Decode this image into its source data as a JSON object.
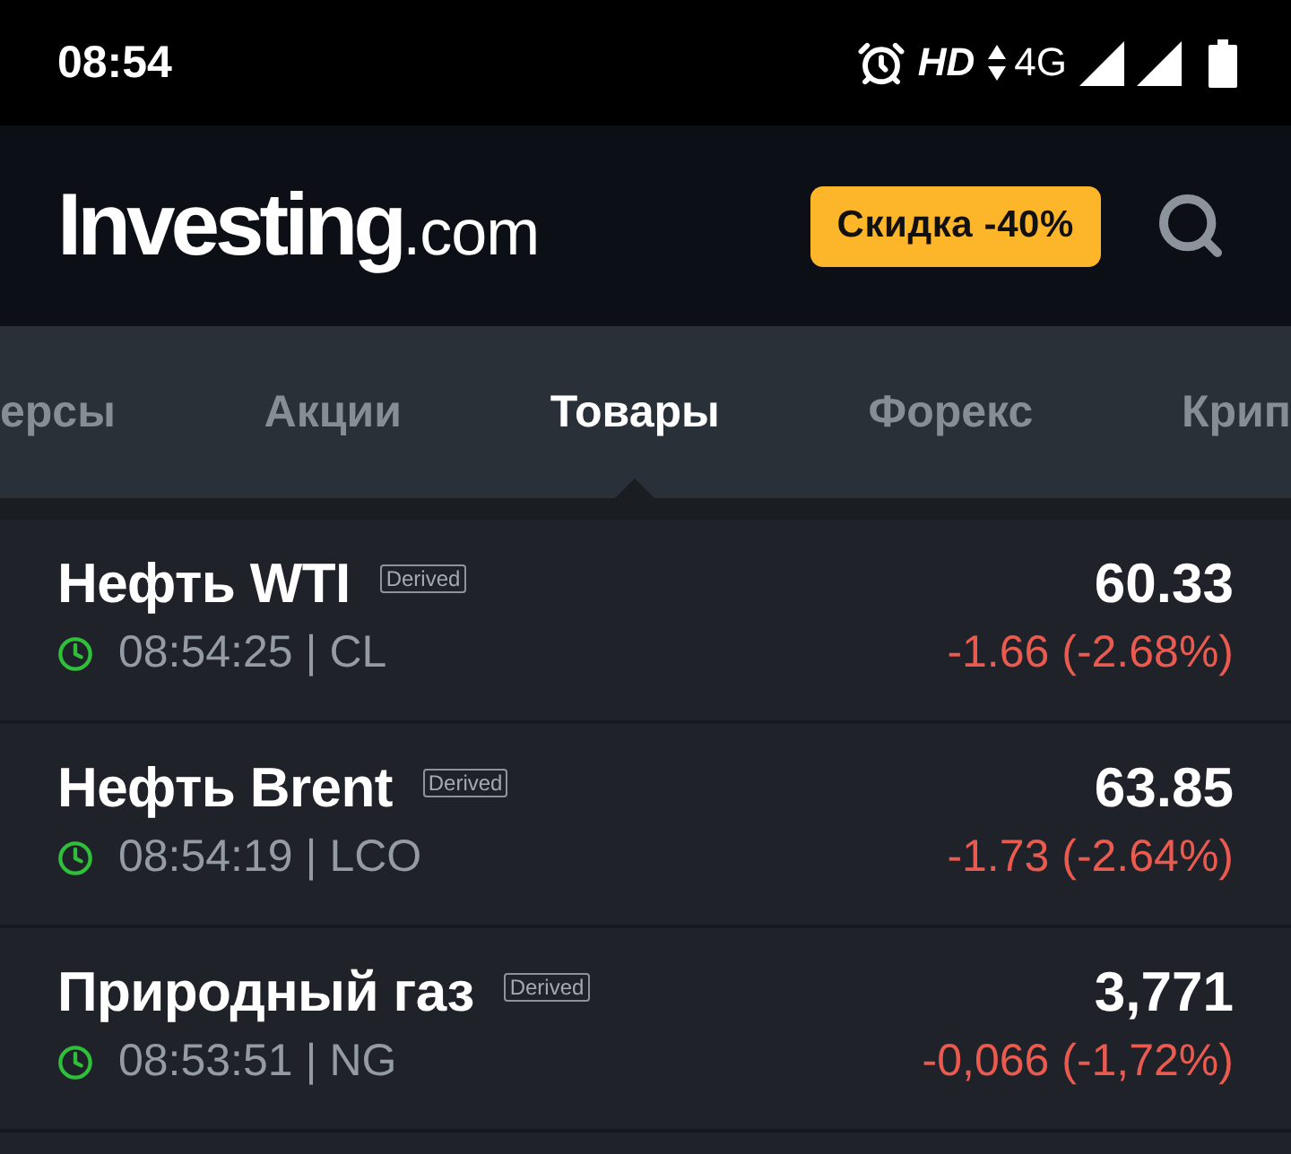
{
  "status_bar": {
    "time": "08:54",
    "hd": "HD",
    "network": "4G"
  },
  "header": {
    "logo": "**Investing**.com",
    "promo": "Скидка -40%"
  },
  "tabs": [
    {
      "label": "ерсы",
      "selected": false
    },
    {
      "label": "Акции",
      "selected": false
    },
    {
      "label": "Товары",
      "selected": true
    },
    {
      "label": "Форекс",
      "selected": false
    },
    {
      "label": "Крип",
      "selected": false
    }
  ],
  "quotes": [
    {
      "name": "Нефть WTI",
      "badge": "Derived",
      "time": "08:54:25 | CL",
      "price": "60.33",
      "change": "-1.66 (-2.68%)",
      "negative": true
    },
    {
      "name": "Нефть Brent",
      "badge": "Derived",
      "time": "08:54:19 | LCO",
      "price": "63.85",
      "change": "-1.73 (-2.64%)",
      "negative": true
    },
    {
      "name": "Природный газ",
      "badge": "Derived",
      "time": "08:53:51 | NG",
      "price": "3,771",
      "change": "-0,066 (-1,72%)",
      "negative": true
    }
  ]
}
